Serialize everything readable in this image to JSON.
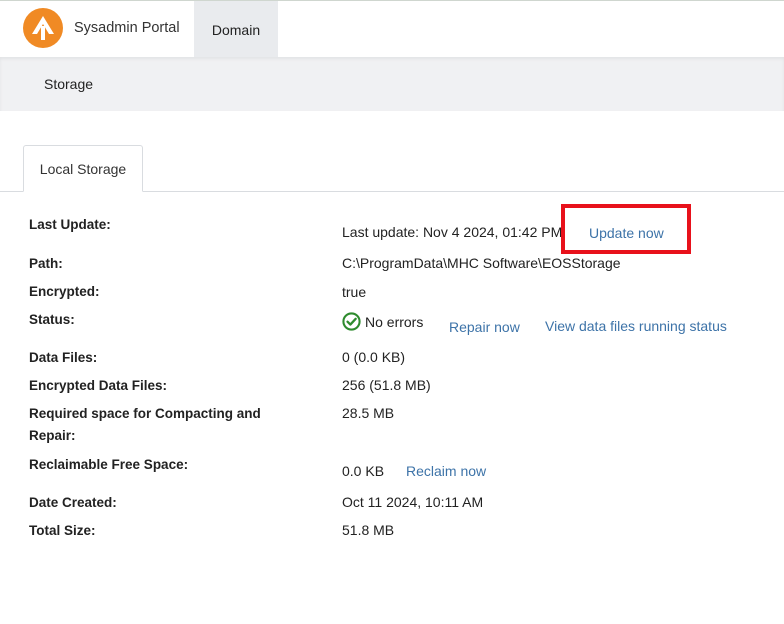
{
  "header": {
    "portal_name": "Sysadmin Portal",
    "active_tab": "Domain",
    "logo_color": "#f08a24"
  },
  "subnav": {
    "item": "Storage"
  },
  "tabs": [
    {
      "label": "Local Storage",
      "active": true
    }
  ],
  "storage": {
    "last_update_label": "Last Update:",
    "last_update_value": "Last update: Nov 4 2024, 01:42 PM",
    "update_now": "Update now",
    "path_label": "Path:",
    "path_value": "C:\\ProgramData\\MHC Software\\EOSStorage",
    "encrypted_label": "Encrypted:",
    "encrypted_value": "true",
    "status_label": "Status:",
    "status_value": "No errors",
    "repair_now": "Repair now",
    "view_status": "View data files running status",
    "data_files_label": "Data Files:",
    "data_files_value": "0 (0.0 KB)",
    "enc_data_files_label": "Encrypted Data Files:",
    "enc_data_files_value": "256 (51.8 MB)",
    "required_space_label_1": "Required space for Compacting and",
    "required_space_label_2": "Repair:",
    "required_space_value": "28.5 MB",
    "reclaimable_label": "Reclaimable Free Space:",
    "reclaimable_value": "0.0 KB",
    "reclaim_now": "Reclaim now",
    "date_created_label": "Date Created:",
    "date_created_value": "Oct 11 2024, 10:11 AM",
    "total_size_label": "Total Size:",
    "total_size_value": "51.8 MB"
  },
  "colors": {
    "link": "#3d73a8",
    "status_ok": "#2e8b2e",
    "highlight": "#e8111b"
  }
}
